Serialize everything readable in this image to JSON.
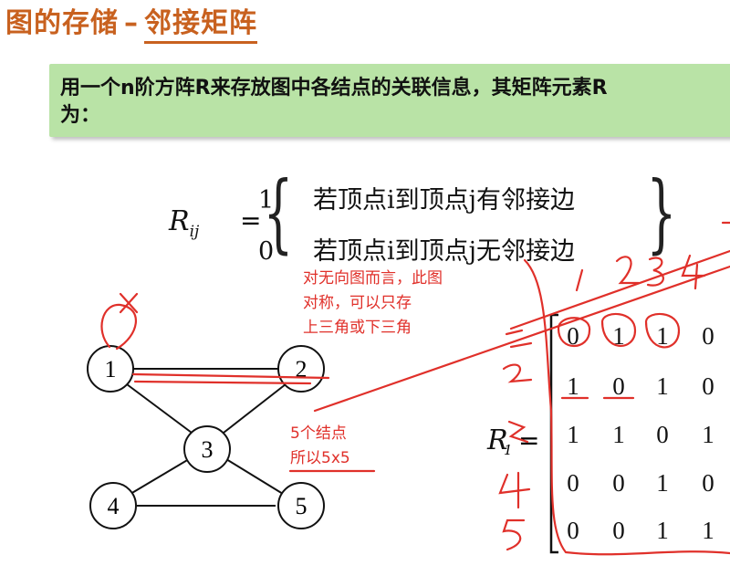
{
  "title": {
    "prefix": "图的存储",
    "dash": "–",
    "highlight": "邻接矩阵"
  },
  "banner": {
    "text": "用一个n阶方阵R来存放图中各结点的关联信息，其矩阵元素R\n为："
  },
  "formula": {
    "lhs": "R",
    "lhs_sub": "ij",
    "eq": "=",
    "row1_value": "1",
    "row1_text": "若顶点i到顶点j有邻接边",
    "row2_value": "0",
    "row2_text": "若顶点i到顶点j无邻接边"
  },
  "annotations": {
    "symmetric_note": [
      "对无向图而言，此图",
      "对称，可以只存",
      "上三角或下三角"
    ],
    "nodes_note": [
      "5个结点",
      "所以5x5"
    ]
  },
  "graph": {
    "nodes": [
      "1",
      "2",
      "3",
      "4",
      "5"
    ],
    "edges": [
      [
        "1",
        "2"
      ],
      [
        "1",
        "3"
      ],
      [
        "2",
        "3"
      ],
      [
        "3",
        "4"
      ],
      [
        "3",
        "5"
      ],
      [
        "4",
        "5"
      ]
    ]
  },
  "matrix": {
    "label": "R",
    "label_sub": "1",
    "eq": "=",
    "rows": [
      [
        "0",
        "1",
        "1",
        "0"
      ],
      [
        "1",
        "0",
        "1",
        "0"
      ],
      [
        "1",
        "1",
        "0",
        "1"
      ],
      [
        "0",
        "0",
        "1",
        "0"
      ],
      [
        "0",
        "0",
        "1",
        "1"
      ]
    ],
    "hand_col_labels": [
      "1",
      "2",
      "3",
      "4"
    ],
    "hand_row_labels": [
      "1",
      "2",
      "3",
      "4",
      "5"
    ]
  },
  "colors": {
    "title": "#c8611f",
    "banner_bg": "#b9e3a6",
    "annotation_red": "#e0302a"
  }
}
